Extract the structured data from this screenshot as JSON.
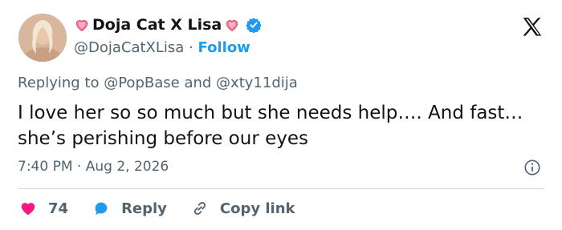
{
  "author": {
    "display_name": "Doja Cat X Lisa",
    "handle": "@DojaCatXLisa",
    "separator": "·",
    "follow_label": "Follow",
    "verified": true
  },
  "replying_to": {
    "prefix": "Replying to",
    "mention1": "@PopBase",
    "conjunction": "and",
    "mention2": "@xty11dija"
  },
  "tweet": {
    "text": "I love her so so much but she needs help…. And fast… she’s perishing before our eyes"
  },
  "meta": {
    "time": "7:40 PM",
    "separator": "·",
    "date": "Aug 2, 2026"
  },
  "actions": {
    "like_count": "74",
    "reply_label": "Reply",
    "copy_label": "Copy link"
  },
  "colors": {
    "accent": "#1d9bf0",
    "like": "#f91880",
    "text": "#0f1419",
    "muted": "#536471"
  },
  "icons": {
    "brand": "x-logo-icon",
    "verified": "verified-badge-icon",
    "name_decoration": "pink-heart-icon",
    "info": "info-icon",
    "like": "heart-icon",
    "reply": "speech-bubble-icon",
    "copy": "link-icon"
  }
}
